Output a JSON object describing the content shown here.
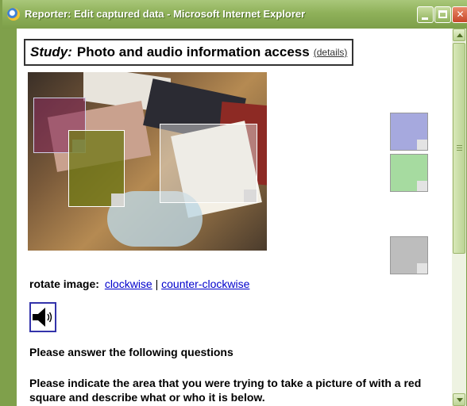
{
  "window": {
    "title": "Reporter: Edit captured data - Microsoft Internet Explorer",
    "accent_color": "#7fa04b"
  },
  "study": {
    "label": "Study:",
    "name": "Photo and audio information access",
    "details_link": "(details)"
  },
  "photo": {
    "overlays": [
      {
        "name": "red-region",
        "color": "#b41e28"
      },
      {
        "name": "green-region",
        "color": "#6e7814"
      },
      {
        "name": "grey-region",
        "color": "#e6e6e6"
      }
    ]
  },
  "swatches": [
    {
      "name": "blue-swatch",
      "color": "#a6a9de"
    },
    {
      "name": "green-swatch",
      "color": "#a6dba0"
    },
    {
      "name": "grey-swatch",
      "color": "#bdbdbd"
    }
  ],
  "rotate": {
    "label": "rotate image:",
    "clockwise": "clockwise",
    "separator": "|",
    "counter_clockwise": "counter-clockwise"
  },
  "audio": {
    "icon": "speaker-icon"
  },
  "questions": {
    "heading": "Please answer the following questions",
    "q1": "Please indicate the area that you were trying to take a picture of with a red square and describe what or who it is below."
  }
}
